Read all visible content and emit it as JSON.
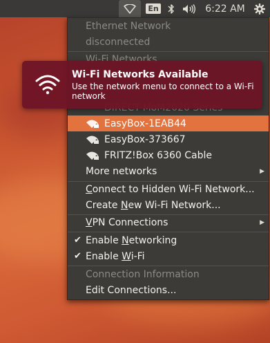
{
  "panel": {
    "keyboard_layout": "En",
    "clock": "6:22 AM",
    "icons": [
      "network-wireless-icon",
      "bluetooth-icon",
      "volume-icon",
      "system-gear-icon"
    ]
  },
  "notification": {
    "title": "Wi-Fi Networks Available",
    "body": "Use the network menu to connect to a Wi-Fi network",
    "icon": "wifi-signal-icon"
  },
  "menu": {
    "ethernet_header": "Ethernet Network",
    "ethernet_status": "disconnected",
    "wifi_header": "Wi-Fi Networks",
    "wifi_networks": [
      {
        "name": "DIRECT-MoM2020 Series",
        "active": false
      },
      {
        "name": "EasyBox-1EAB44",
        "active": true
      },
      {
        "name": "EasyBox-373667",
        "active": false
      },
      {
        "name": "FRITZ!Box 6360 Cable",
        "active": false
      }
    ],
    "more_networks": "More networks",
    "connect_hidden": {
      "pre": "",
      "u": "C",
      "post": "onnect to Hidden Wi-Fi Network..."
    },
    "create_new": {
      "pre": "Create ",
      "u": "N",
      "post": "ew Wi-Fi Network..."
    },
    "vpn": {
      "pre": "",
      "u": "V",
      "post": "PN Connections"
    },
    "enable_networking": {
      "pre": "Enable ",
      "u": "N",
      "post": "etworking",
      "checked": true
    },
    "enable_wifi": {
      "pre": "Enable ",
      "u": "W",
      "post": "i-Fi",
      "checked": true
    },
    "connection_information": "Connection Information",
    "edit_connections": "Edit Connections...",
    "check_glyph": "✔",
    "submenu_arrow": "▶"
  },
  "colors": {
    "panel_bg": "#3a3937",
    "menu_bg": "#3c3b37",
    "highlight": "#e2733f",
    "notification_bg": "#6e1426",
    "disabled_text": "#8b8a85"
  }
}
